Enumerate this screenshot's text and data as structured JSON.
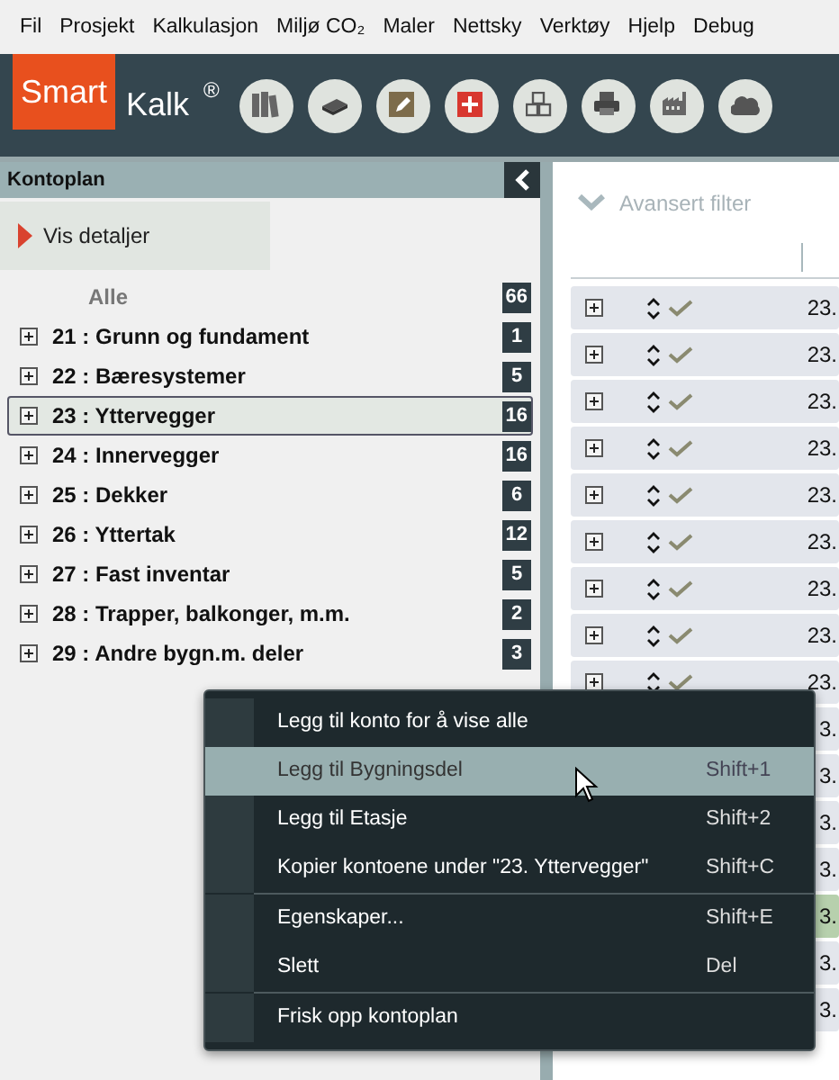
{
  "menubar": [
    "Fil",
    "Prosjekt",
    "Kalkulasjon",
    "Miljø CO₂",
    "Maler",
    "Nettsky",
    "Verktøy",
    "Hjelp",
    "Debug"
  ],
  "logo": {
    "part_1": "Smart",
    "part_2": "Kalk",
    "mark": "®"
  },
  "toolbar": [
    {
      "kind": "books"
    },
    {
      "kind": "book"
    },
    {
      "kind": "edit"
    },
    {
      "kind": "add"
    },
    {
      "kind": "cubes"
    },
    {
      "kind": "print"
    },
    {
      "kind": "factory"
    },
    {
      "kind": "co2"
    }
  ],
  "left_panel": {
    "title": "Kontoplan",
    "details_link": "Vis detaljer",
    "tree": [
      {
        "kind": "all",
        "label": "Alle",
        "count": "66",
        "selected": false
      },
      {
        "kind": "account",
        "label": "21 : Grunn og fundament",
        "count": "1",
        "selected": false
      },
      {
        "kind": "account",
        "label": "22 : Bæresystemer",
        "count": "5",
        "selected": false
      },
      {
        "kind": "account",
        "label": "23 : Yttervegger",
        "count": "16",
        "selected": true
      },
      {
        "kind": "account",
        "label": "24 : Innervegger",
        "count": "16",
        "selected": false
      },
      {
        "kind": "account",
        "label": "25 : Dekker",
        "count": "6",
        "selected": false
      },
      {
        "kind": "account",
        "label": "26 : Yttertak",
        "count": "12",
        "selected": false
      },
      {
        "kind": "account",
        "label": "27 : Fast inventar",
        "count": "5",
        "selected": false
      },
      {
        "kind": "account",
        "label": "28 : Trapper, balkonger, m.m.",
        "count": "2",
        "selected": false
      },
      {
        "kind": "account",
        "label": "29 : Andre bygn.m. deler",
        "count": "3",
        "selected": false
      }
    ]
  },
  "right_panel": {
    "filter": "Avansert filter",
    "rows": [
      {
        "kind": "full",
        "text": "23.",
        "selected": false
      },
      {
        "kind": "full",
        "text": "23.",
        "selected": false
      },
      {
        "kind": "full",
        "text": "23.",
        "selected": false
      },
      {
        "kind": "full",
        "text": "23.",
        "selected": false
      },
      {
        "kind": "full",
        "text": "23.",
        "selected": false
      },
      {
        "kind": "full",
        "text": "23.",
        "selected": false
      },
      {
        "kind": "full",
        "text": "23.",
        "selected": false
      },
      {
        "kind": "full",
        "text": "23.",
        "selected": false
      },
      {
        "kind": "full",
        "text": "23.",
        "selected": false
      },
      {
        "kind": "edge",
        "text": "3.",
        "selected": false
      },
      {
        "kind": "edge",
        "text": "3.",
        "selected": false
      },
      {
        "kind": "edge",
        "text": "3.",
        "selected": false
      },
      {
        "kind": "edge",
        "text": "3.",
        "selected": false
      },
      {
        "kind": "edge",
        "text": "3.",
        "selected": true
      },
      {
        "kind": "edge",
        "text": "3.",
        "selected": false
      },
      {
        "kind": "edge",
        "text": "3.",
        "selected": false
      }
    ]
  },
  "context_menu": [
    {
      "label": "Legg til konto for å vise alle",
      "separator_before": false,
      "selected": false
    },
    {
      "label": "Legg til Bygningsdel",
      "shortcut": "Shift+1",
      "separator_before": false,
      "selected": true
    },
    {
      "label": "Legg til Etasje",
      "shortcut": "Shift+2",
      "separator_before": false,
      "selected": false
    },
    {
      "label": "Kopier kontoene under \"23. Yttervegger\"",
      "shortcut": "Shift+C",
      "separator_before": false,
      "selected": false
    },
    {
      "label": "Egenskaper...",
      "shortcut": "Shift+E",
      "separator_before": true,
      "selected": false
    },
    {
      "label": "Slett",
      "shortcut": "Del",
      "separator_before": false,
      "selected": false
    },
    {
      "label": "Frisk opp kontoplan",
      "separator_before": true,
      "selected": false
    }
  ]
}
